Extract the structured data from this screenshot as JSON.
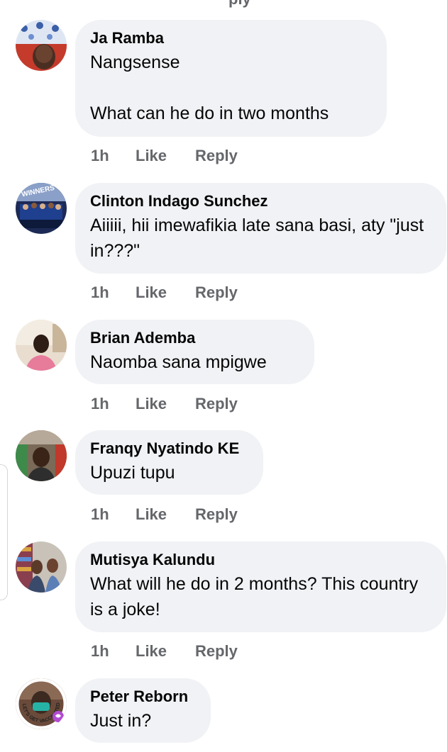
{
  "top_fragment": "ply",
  "comments": [
    {
      "author": "Ja Ramba",
      "text": "Nangsense\n\nWhat can he do in two months",
      "time": "1h",
      "like_label": "Like",
      "reply_label": "Reply",
      "avatar_icon": "profile-photo-icon"
    },
    {
      "author": "Clinton Indago Sunchez",
      "text": "Aiiiii,  hii imewafikia late sana basi, aty \"just in???\"",
      "time": "1h",
      "like_label": "Like",
      "reply_label": "Reply",
      "avatar_icon": "profile-photo-icon",
      "avatar_caption": "WINNERS"
    },
    {
      "author": "Brian Ademba",
      "text": "Naomba sana mpigwe",
      "time": "1h",
      "like_label": "Like",
      "reply_label": "Reply",
      "avatar_icon": "profile-photo-icon"
    },
    {
      "author": "Franqy Nyatindo KE",
      "text": "Upuzi tupu",
      "time": "1h",
      "like_label": "Like",
      "reply_label": "Reply",
      "avatar_icon": "profile-photo-icon"
    },
    {
      "author": "Mutisya Kalundu",
      "text": "What will he do in 2 months? This country is a joke!",
      "time": "1h",
      "like_label": "Like",
      "reply_label": "Reply",
      "avatar_icon": "profile-photo-icon"
    },
    {
      "author": "Peter Reborn",
      "text": "Just in?",
      "avatar_icon": "profile-photo-icon",
      "avatar_caption": "LET'S GET VACCINATED"
    }
  ]
}
